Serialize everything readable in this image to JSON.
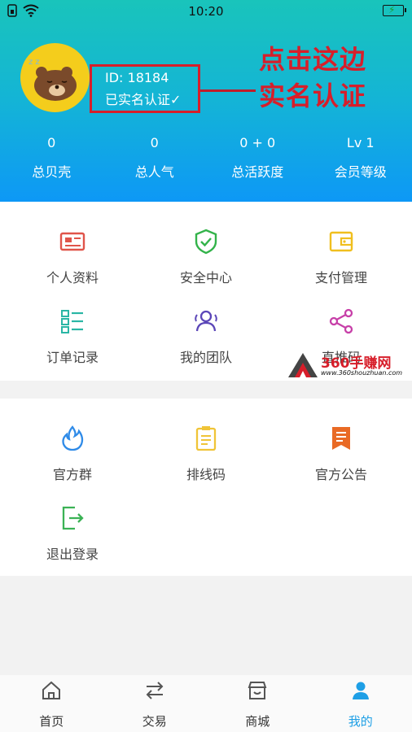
{
  "status_bar": {
    "time": "10:20"
  },
  "profile": {
    "id_label": "ID: 18184",
    "verified_label": "已实名认证✓"
  },
  "annotation": {
    "line1": "点击这边",
    "line2": "实名认证"
  },
  "stats": [
    {
      "value": "0",
      "label": "总贝壳"
    },
    {
      "value": "0",
      "label": "总人气"
    },
    {
      "value": "0 + 0",
      "label": "总活跃度"
    },
    {
      "value": "Lv 1",
      "label": "会员等级"
    }
  ],
  "menu1": [
    {
      "label": "个人资料",
      "icon": "id-card-icon",
      "color": "#e0544a"
    },
    {
      "label": "安全中心",
      "icon": "shield-check-icon",
      "color": "#33b34a"
    },
    {
      "label": "支付管理",
      "icon": "wallet-icon",
      "color": "#f0bf1f"
    },
    {
      "label": "订单记录",
      "icon": "list-icon",
      "color": "#2ab6a5"
    },
    {
      "label": "我的团队",
      "icon": "team-icon",
      "color": "#5b46b8"
    },
    {
      "label": "直推码",
      "icon": "share-icon",
      "color": "#c73fa8"
    }
  ],
  "menu2": [
    {
      "label": "官方群",
      "icon": "flame-icon",
      "color": "#2f8be8"
    },
    {
      "label": "排线码",
      "icon": "clipboard-icon",
      "color": "#f0c437"
    },
    {
      "label": "官方公告",
      "icon": "notice-icon",
      "color": "#e96a25"
    },
    {
      "label": "退出登录",
      "icon": "logout-icon",
      "color": "#3bb255"
    }
  ],
  "watermark": {
    "name": "360手赚网",
    "url": "www.360shouzhuan.com"
  },
  "tabs": [
    {
      "label": "首页",
      "icon": "home-icon",
      "active": false
    },
    {
      "label": "交易",
      "icon": "swap-icon",
      "active": false
    },
    {
      "label": "商城",
      "icon": "shop-icon",
      "active": false
    },
    {
      "label": "我的",
      "icon": "user-icon",
      "active": true
    }
  ]
}
